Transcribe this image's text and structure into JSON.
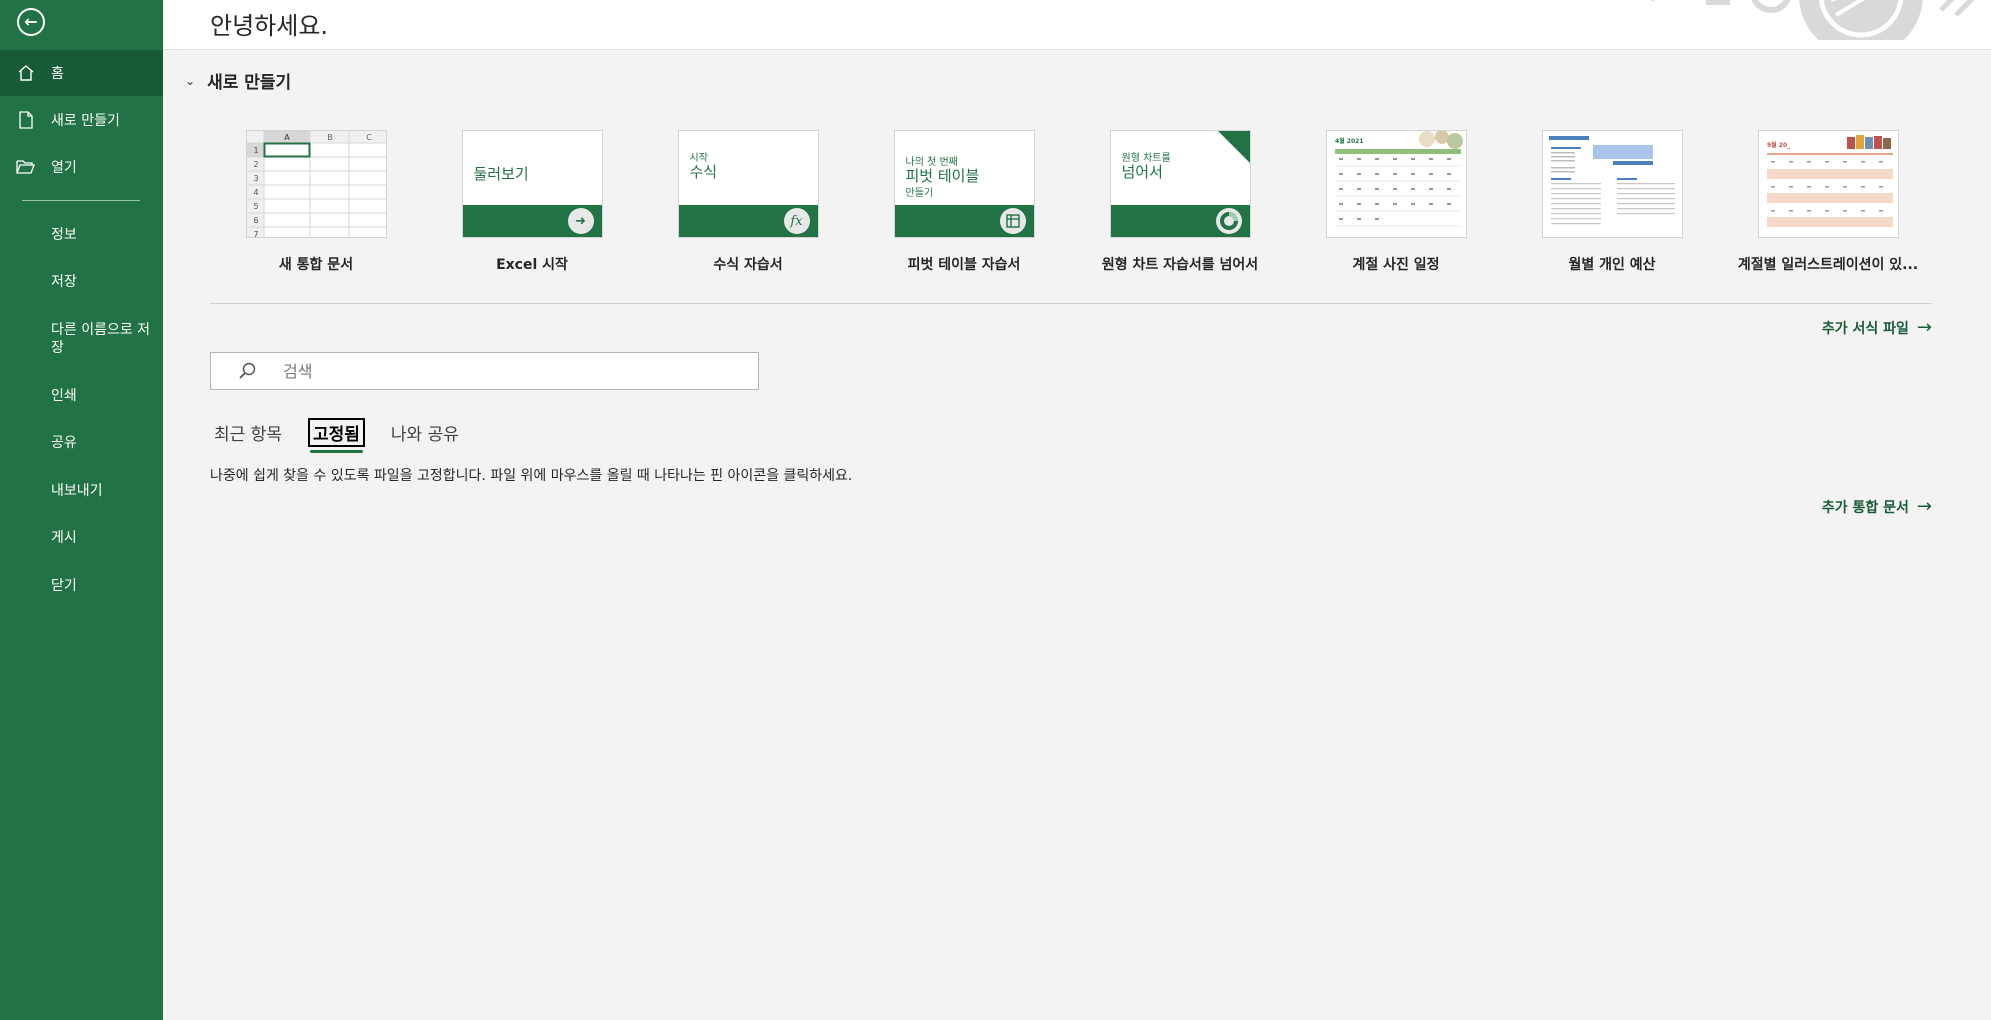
{
  "sidebar": {
    "back_icon": "back-arrow-icon",
    "items": [
      {
        "label": "홈",
        "icon": "home-icon"
      },
      {
        "label": "새로 만들기",
        "icon": "new-file-icon"
      },
      {
        "label": "열기",
        "icon": "open-folder-icon"
      },
      {
        "label": "정보"
      },
      {
        "label": "저장"
      },
      {
        "label": "다른 이름으로 저장"
      },
      {
        "label": "인쇄"
      },
      {
        "label": "공유"
      },
      {
        "label": "내보내기"
      },
      {
        "label": "게시"
      },
      {
        "label": "닫기"
      }
    ],
    "active": "홈",
    "color": "#217346"
  },
  "header": {
    "greeting": "안녕하세요."
  },
  "new_section": {
    "title": "새로 만들기",
    "templates": [
      {
        "label": "새 통합 문서",
        "cols": [
          "A",
          "B",
          "C"
        ],
        "rows": [
          "1",
          "2",
          "3",
          "4",
          "5",
          "6",
          "7"
        ]
      },
      {
        "label": "Excel 시작",
        "thumb_text": "둘러보기"
      },
      {
        "label": "수식 자습서",
        "thumb_small": "시작",
        "thumb_text": "수식",
        "thumb_icon": "fx"
      },
      {
        "label": "피벗 테이블 자습서",
        "thumb_small": "나의 첫 번째",
        "thumb_text": "피벗 테이블",
        "thumb_small2": "만들기"
      },
      {
        "label": "원형 차트 자습서를 넘어서",
        "thumb_small": "원형 차트를",
        "thumb_text": "넘어서"
      },
      {
        "label": "계절 사진 일정",
        "thumb_text": "4월 2021"
      },
      {
        "label": "월별 개인 예산"
      },
      {
        "label": "계절별 일러스트레이션이 있...",
        "thumb_text": "9월 20_"
      }
    ],
    "more_label": "추가 서식 파일"
  },
  "search": {
    "placeholder": "검색"
  },
  "tabs": [
    "최근 항목",
    "고정됨",
    "나와 공유"
  ],
  "active_tab": "고정됨",
  "pinned_hint": "나중에 쉽게 찾을 수 있도록 파일을 고정합니다. 파일 위에 마우스를 올릴 때 나타나는 핀 아이콘을 클릭하세요.",
  "more_workbooks_label": "추가 통합 문서"
}
